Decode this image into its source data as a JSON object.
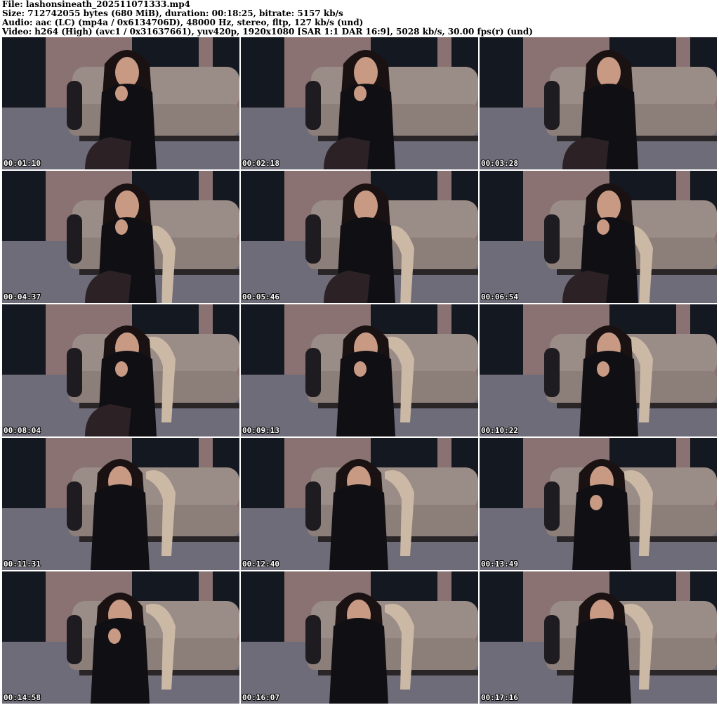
{
  "header": {
    "file": "File: lashonsineath_202511071333.mp4",
    "size": "Size: 712742055 bytes (680 MiB), duration: 00:18:25, bitrate: 5157 kb/s",
    "audio": "Audio: aac (LC) (mp4a / 0x6134706D), 48000 Hz, stereo, fltp, 127 kb/s (und)",
    "video": "Video: h264 (High) (avc1 / 0x31637661), yuv420p, 1920x1080 [SAR 1:1 DAR 16:9], 5028 kb/s, 30.00 fps(r) (und)"
  },
  "thumbnails": [
    {
      "time": "00:01:10"
    },
    {
      "time": "00:02:18"
    },
    {
      "time": "00:03:28"
    },
    {
      "time": "00:04:37"
    },
    {
      "time": "00:05:46"
    },
    {
      "time": "00:06:54"
    },
    {
      "time": "00:08:04"
    },
    {
      "time": "00:09:13"
    },
    {
      "time": "00:10:22"
    },
    {
      "time": "00:11:31"
    },
    {
      "time": "00:12:40"
    },
    {
      "time": "00:13:49"
    },
    {
      "time": "00:14:58"
    },
    {
      "time": "00:16:07"
    },
    {
      "time": "00:17:16"
    }
  ],
  "colors": {
    "curtain_dark": "#141820",
    "wall_mauve": "#8a7272",
    "floor_gray": "#6e6c78",
    "sofa_beige": "#9a8c86",
    "outfit_black": "#101014",
    "hair_dark": "#1a1212",
    "skin": "#c89a84",
    "chair_frame": "#cbb9a6"
  }
}
